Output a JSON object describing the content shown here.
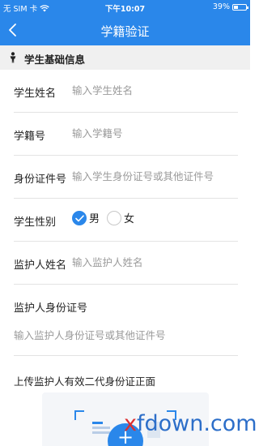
{
  "status_bar": {
    "carrier": "无 SIM 卡",
    "time": "下午10:07",
    "battery": "39%",
    "battery_level": 0.39
  },
  "nav": {
    "title": "学籍验证"
  },
  "section": {
    "title": "学生基础信息"
  },
  "form": {
    "student_name": {
      "label": "学生姓名",
      "placeholder": "输入学生姓名"
    },
    "student_id": {
      "label": "学籍号",
      "placeholder": "输入学籍号"
    },
    "id_number": {
      "label": "身份证件号",
      "placeholder": "输入学生身份证号或其他证件号"
    },
    "gender": {
      "label": "学生性别",
      "male": "男",
      "female": "女",
      "selected": "男"
    },
    "guardian_name": {
      "label": "监护人姓名",
      "placeholder": "输入监护人姓名"
    },
    "guardian_id": {
      "label": "监护人身份证号",
      "placeholder": "输入监护人身份证号或其他证件号"
    }
  },
  "upload": {
    "label": "上传监护人有效二代身份证正面",
    "button": "+"
  },
  "watermark": {
    "prefix": "x",
    "text": "fdown.com"
  },
  "colors": {
    "accent": "#2a87ea",
    "section_bg": "#f0f0f0"
  }
}
